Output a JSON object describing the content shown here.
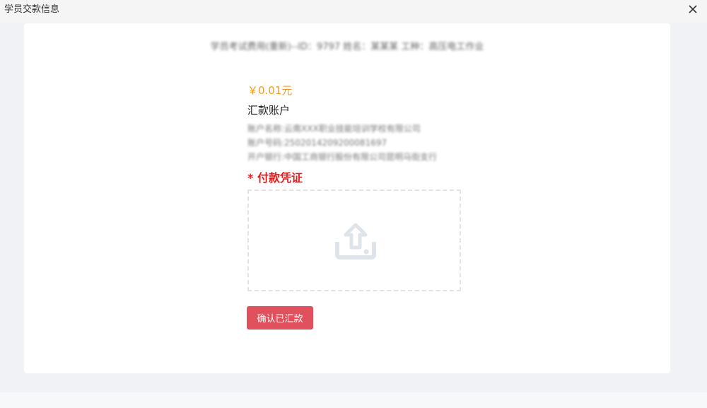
{
  "window": {
    "title": "学员交款信息",
    "close_icon": "close-icon"
  },
  "student_info": "学员考试费用(重新)--ID：9797 姓名：某某某 工种：高压电工作业",
  "amount": "￥0.01元",
  "account": {
    "title": "汇款账户",
    "lines": [
      "账户名称:云南XXX职业技能培训学校有限公司",
      "账户号码:2502014209200081697",
      "开户银行:中国工商银行股份有限公司昆明马街支行"
    ]
  },
  "voucher": {
    "label": "* 付款凭证",
    "upload_icon": "upload-icon"
  },
  "confirm_button": "确认已汇款",
  "colors": {
    "amount": "#f59a23",
    "required": "#e02020",
    "button": "#e0505d"
  }
}
